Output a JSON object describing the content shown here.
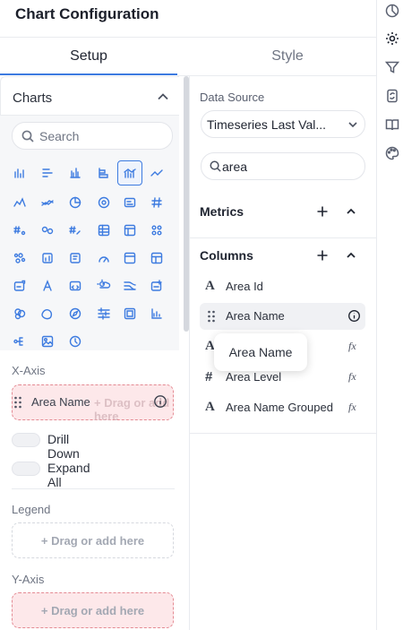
{
  "header": {
    "title": "Chart Configuration"
  },
  "tabs": [
    {
      "label": "Setup",
      "active": true
    },
    {
      "label": "Style",
      "active": false
    }
  ],
  "right_rail": {
    "icons": [
      "chart-pie-icon",
      "gear-icon",
      "filter-icon",
      "refresh-doc-icon",
      "book-icon",
      "palette-icon"
    ]
  },
  "charts_panel": {
    "label": "Charts",
    "search_placeholder": "Search",
    "selected_index": 4
  },
  "x_axis": {
    "label": "X-Axis",
    "field_chip": "Area Name",
    "drop_placeholder": "+ Drag or add here"
  },
  "toggles": {
    "drill_down": "Drill Down",
    "expand_all": "Expand All"
  },
  "legend": {
    "label": "Legend",
    "drop_placeholder": "+ Drag or add here"
  },
  "y_axis": {
    "label": "Y-Axis",
    "drop_placeholder": "+ Drag or add here"
  },
  "data_source": {
    "label": "Data Source",
    "value": "Timeseries Last Val..."
  },
  "field_search": {
    "value": "area"
  },
  "metrics": {
    "title": "Metrics"
  },
  "columns": {
    "title": "Columns",
    "items": [
      {
        "type": "A",
        "name": "Area Id",
        "suffix": ""
      },
      {
        "type": "grip",
        "name": "Area Name",
        "suffix": "info"
      },
      {
        "type": "A",
        "name": "er",
        "suffix": "fx"
      },
      {
        "type": "#",
        "name": "Area Level",
        "suffix": "fx"
      },
      {
        "type": "A",
        "name": "Area Name Grouped",
        "suffix": "fx"
      }
    ]
  },
  "tooltip": {
    "text": "Area Name"
  },
  "colors": {
    "accent": "#3d7be0",
    "drop_red_bg": "#fde8ea",
    "drop_red_border": "#e48a93"
  }
}
